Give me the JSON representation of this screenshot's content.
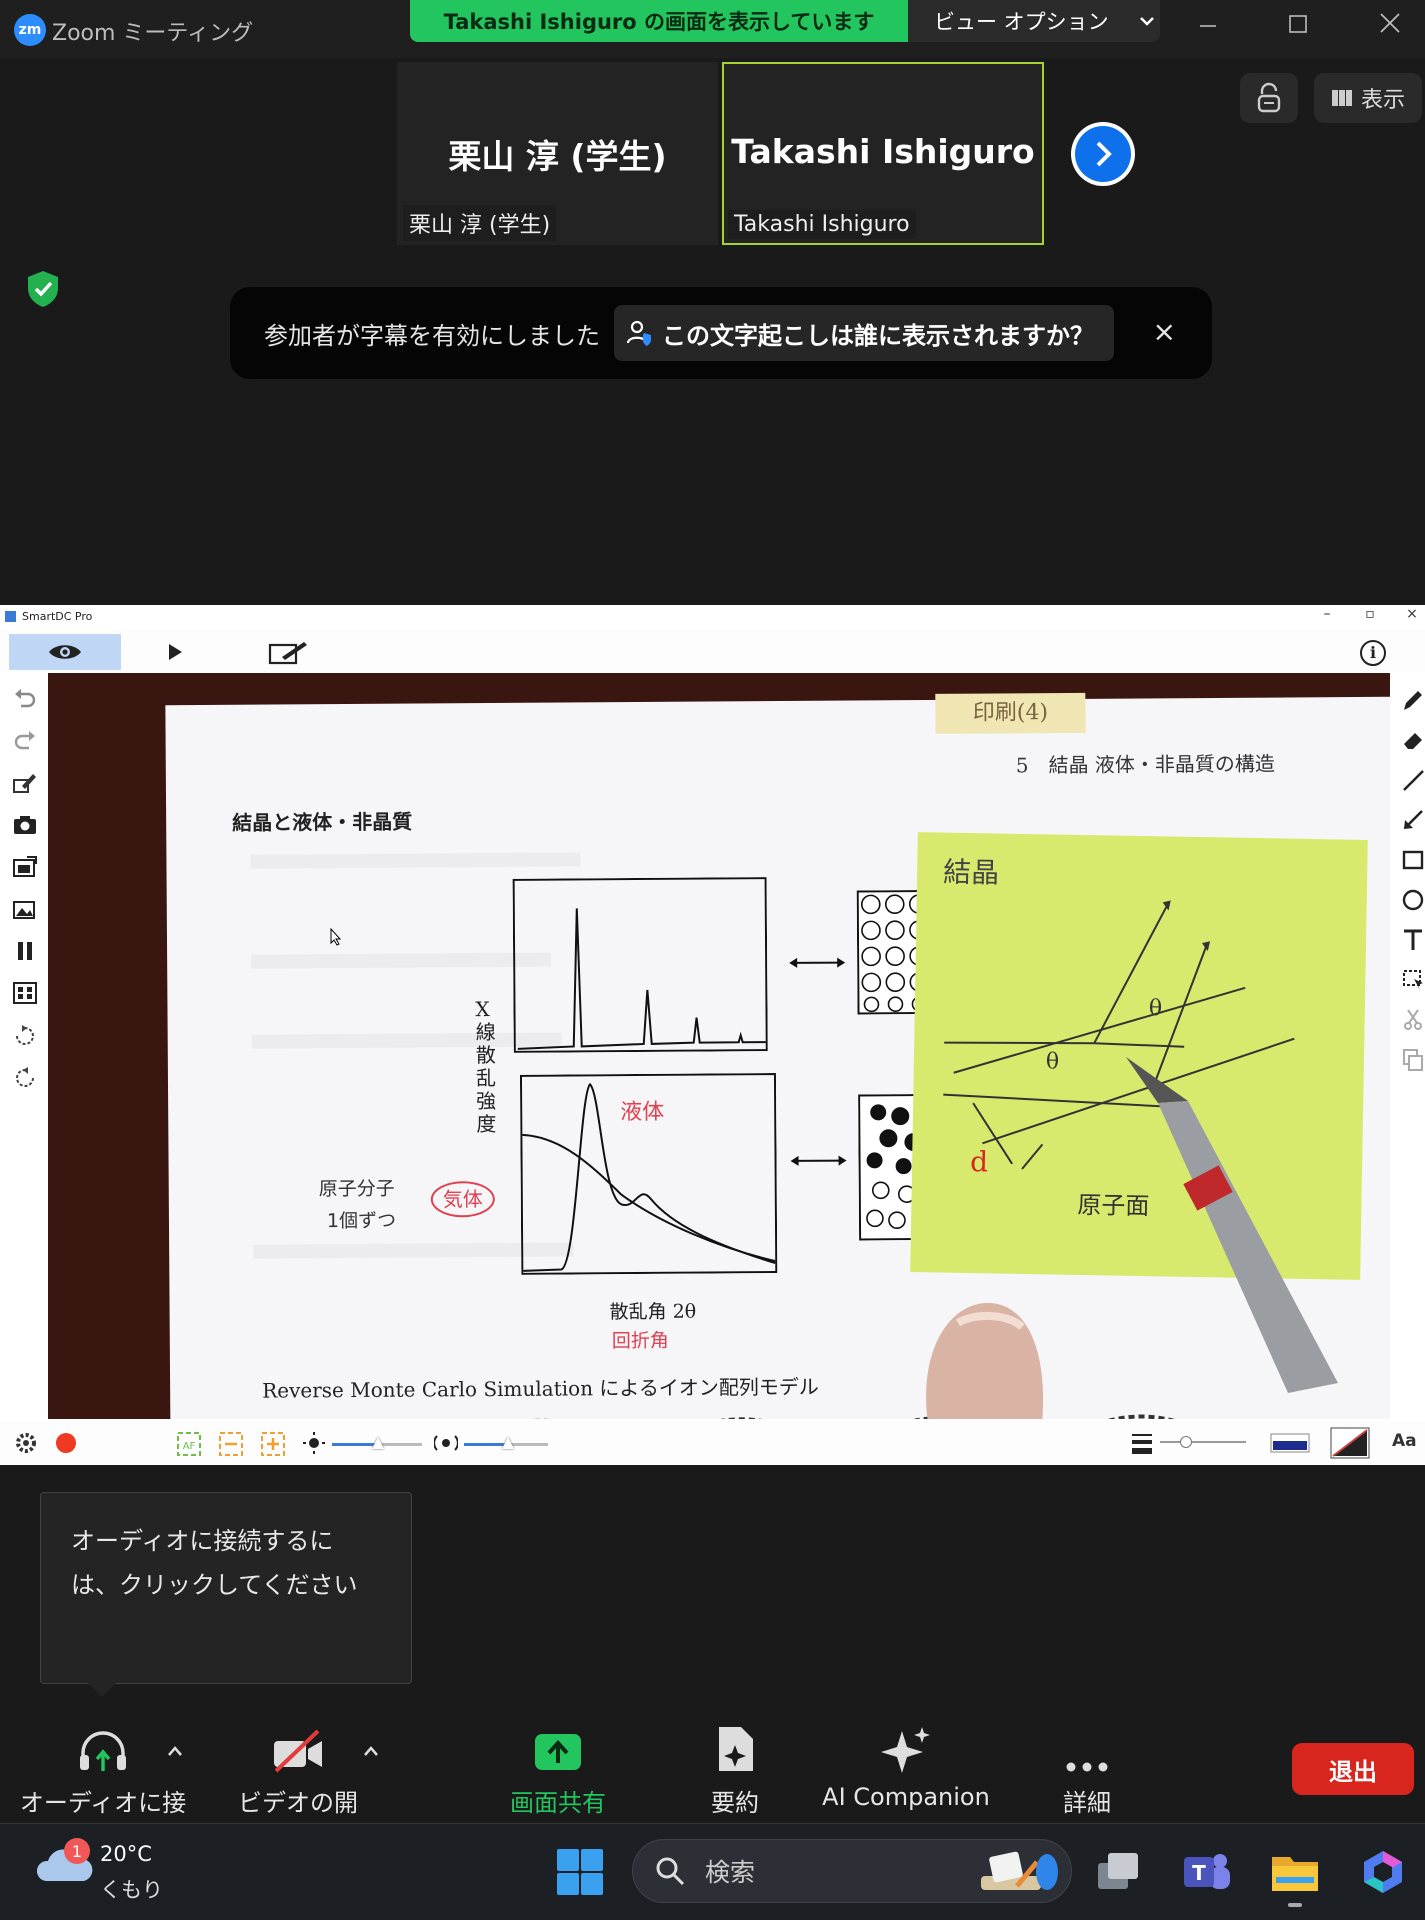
{
  "titlebar": {
    "logo_text": "zm",
    "title": "Zoom ミーティング",
    "sharing_banner": "Takashi  Ishiguro の画面を表示しています",
    "view_options": "ビュー オプション",
    "window_controls": [
      "minimize",
      "maximize",
      "close"
    ]
  },
  "participants": [
    {
      "display": "栗山 淳 (学生)",
      "label": "栗山 淳 (学生)",
      "active": false
    },
    {
      "display": "Takashi Ishiguro",
      "label": "Takashi Ishiguro",
      "active": true
    }
  ],
  "top_right": {
    "view_label": "表示"
  },
  "caption_notice": {
    "message": "参加者が字幕を有効にしました",
    "who_sees": "この文字起こしは誰に表示されますか？",
    "close": "×"
  },
  "smartdc": {
    "title": "SmartDC Pro",
    "controls": [
      "–",
      "▫",
      "×"
    ],
    "info": "i"
  },
  "document": {
    "tag": "印刷(4)",
    "chapter": "5　結晶  液体・非晶質の構造",
    "heading": "結晶と液体・非晶質",
    "y_axis": "X線散乱強度",
    "annotation_liquid": "液体",
    "annotation_gas": "気体",
    "annotation_left1": "原子分子",
    "annotation_left2": "1個ずつ",
    "x_axis": "散乱角 2θ",
    "x_axis_note": "回折角",
    "footer": "Reverse Monte Carlo Simulation によるイオン配列モデル"
  },
  "sticky": {
    "title": "結晶",
    "theta1": "θ",
    "theta2": "θ",
    "d": "d",
    "atom_plane": "原子面"
  },
  "sdc_bottom": {
    "font_label": "Aa"
  },
  "audio_tooltip": "オーディオに接続するには、クリックしてください",
  "toolbar": {
    "audio": "オーディオに接続",
    "video": "ビデオの開始",
    "share": "画面共有",
    "summary": "要約",
    "ai": "AI Companion",
    "more": "詳細",
    "leave": "退出"
  },
  "taskbar": {
    "weather_badge": "1",
    "temperature": "20°C",
    "condition": "くもり",
    "search_placeholder": "検索"
  },
  "colors": {
    "share_green": "#23c55e",
    "zoom_blue": "#0e71eb",
    "leave_red": "#d8261f",
    "sticky_yellow": "#d7ea6e"
  }
}
